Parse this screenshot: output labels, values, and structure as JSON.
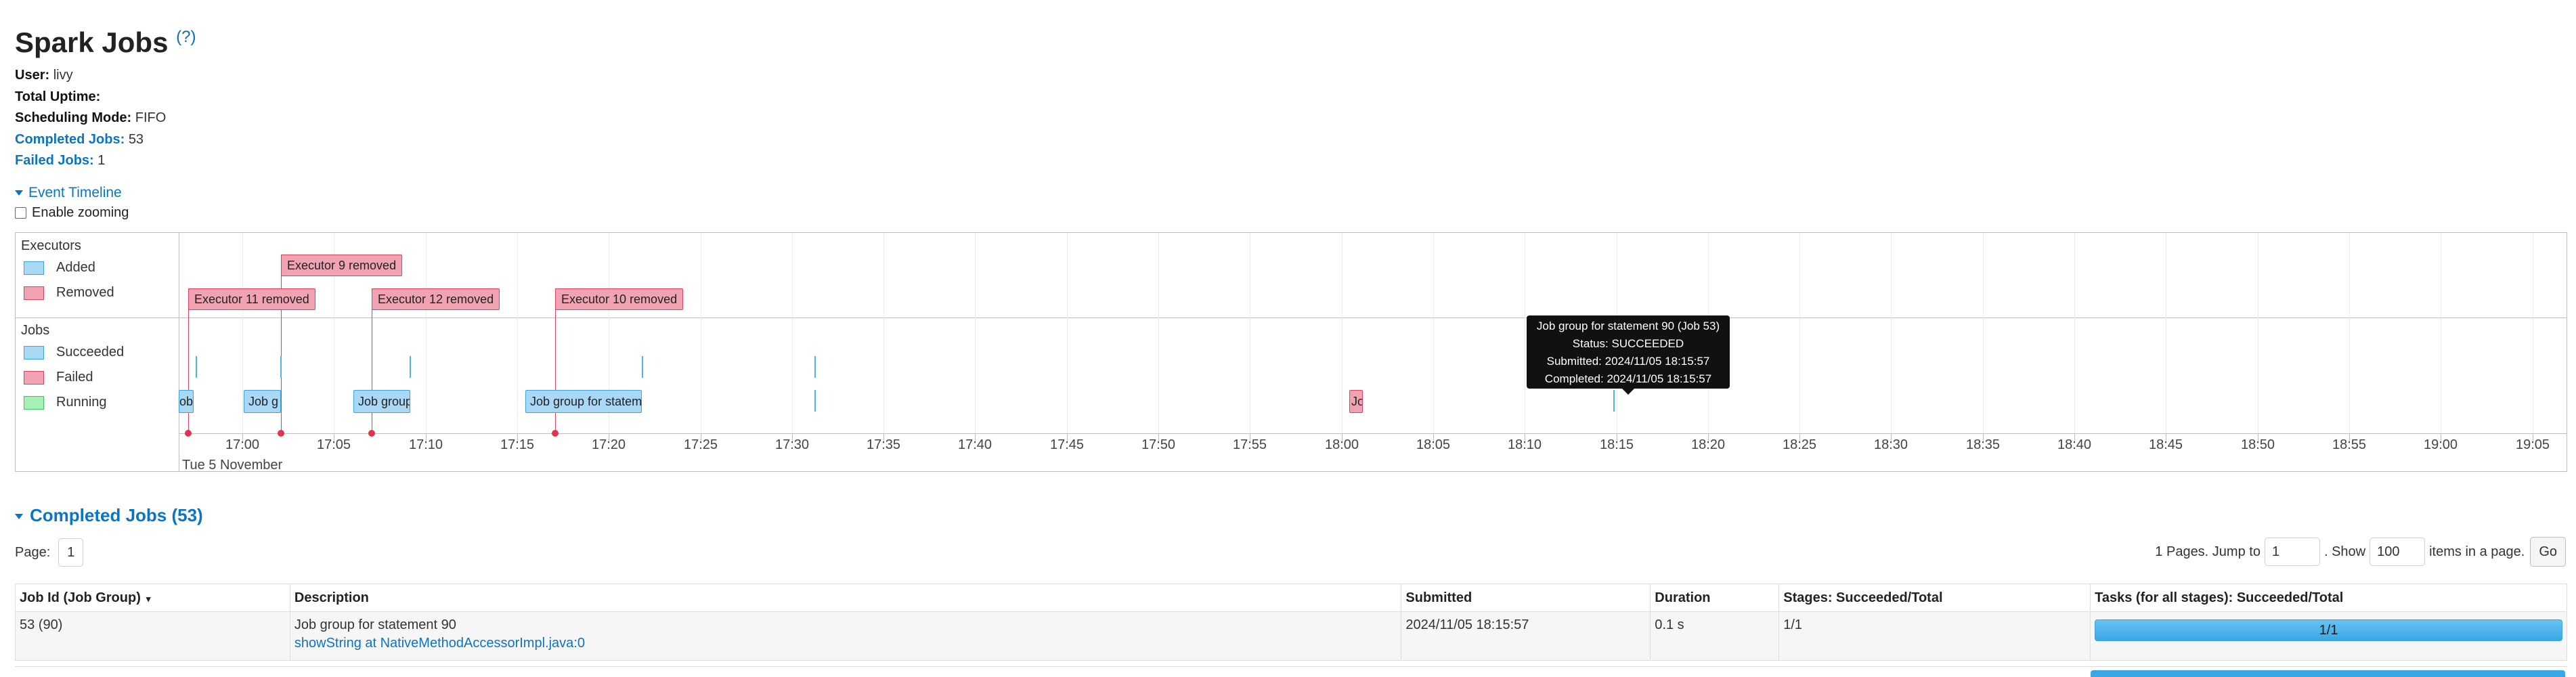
{
  "page": {
    "title": "Spark Jobs",
    "help_marker": "(?)"
  },
  "info": {
    "user_label": "User:",
    "user_value": "livy",
    "uptime_label": "Total Uptime:",
    "uptime_value": "",
    "scheduling_label": "Scheduling Mode:",
    "scheduling_value": "FIFO",
    "completed_label": "Completed Jobs:",
    "completed_value": "53",
    "failed_label": "Failed Jobs:",
    "failed_value": "1"
  },
  "timeline": {
    "toggle_label": "Event Timeline",
    "zoom_label": "Enable zooming",
    "executors_group": "Executors",
    "legend_added": "Added",
    "legend_removed": "Removed",
    "jobs_group": "Jobs",
    "legend_succeeded": "Succeeded",
    "legend_failed": "Failed",
    "legend_running": "Running",
    "day_label": "Tue 5 November",
    "ticks": [
      "17:00",
      "17:05",
      "17:10",
      "17:15",
      "17:20",
      "17:25",
      "17:30",
      "17:35",
      "17:40",
      "17:45",
      "17:50",
      "17:55",
      "18:00",
      "18:05",
      "18:10",
      "18:15",
      "18:20",
      "18:25",
      "18:30",
      "18:35",
      "18:40",
      "18:45",
      "18:50",
      "18:55",
      "19:00",
      "19:05"
    ],
    "executor_events": {
      "exec9": "Executor 9 removed",
      "exec11": "Executor 11 removed",
      "exec12": "Executor 12 removed",
      "exec10": "Executor 10 removed"
    },
    "job_bars": {
      "bar1": "ob",
      "bar2": "Job g",
      "bar3": "Job group",
      "bar4": "Job group for statem",
      "bar5": "Jo"
    },
    "colors": {
      "added": "#a8d8f5",
      "removed": "#f2a3b3",
      "succeeded": "#a8d8f5",
      "failed": "#f2a3b3",
      "running": "#a6f0b8"
    },
    "tooltip": {
      "line1": "Job group for statement 90 (Job 53)",
      "line2": "Status: SUCCEEDED",
      "line3": "Submitted: 2024/11/05 18:15:57",
      "line4": "Completed: 2024/11/05 18:15:57"
    }
  },
  "completed_section": {
    "title": "Completed Jobs (53)",
    "page_label": "Page:",
    "page_value": "1",
    "pages_text": "1 Pages. Jump to",
    "jump_value": "1",
    "show_text": ". Show",
    "show_value": "100",
    "items_text": "items in a page.",
    "go_label": "Go"
  },
  "table": {
    "headers": {
      "job_id": "Job Id (Job Group)",
      "description": "Description",
      "submitted": "Submitted",
      "duration": "Duration",
      "stages": "Stages: Succeeded/Total",
      "tasks": "Tasks (for all stages): Succeeded/Total"
    },
    "sort_indicator": "▾",
    "rows": [
      {
        "job_id": "53 (90)",
        "description": "Job group for statement 90",
        "description_link": "showString at NativeMethodAccessorImpl.java:0",
        "submitted": "2024/11/05 18:15:57",
        "duration": "0.1 s",
        "stages": "1/1",
        "tasks": "1/1",
        "tasks_progress": 1.0
      }
    ]
  }
}
